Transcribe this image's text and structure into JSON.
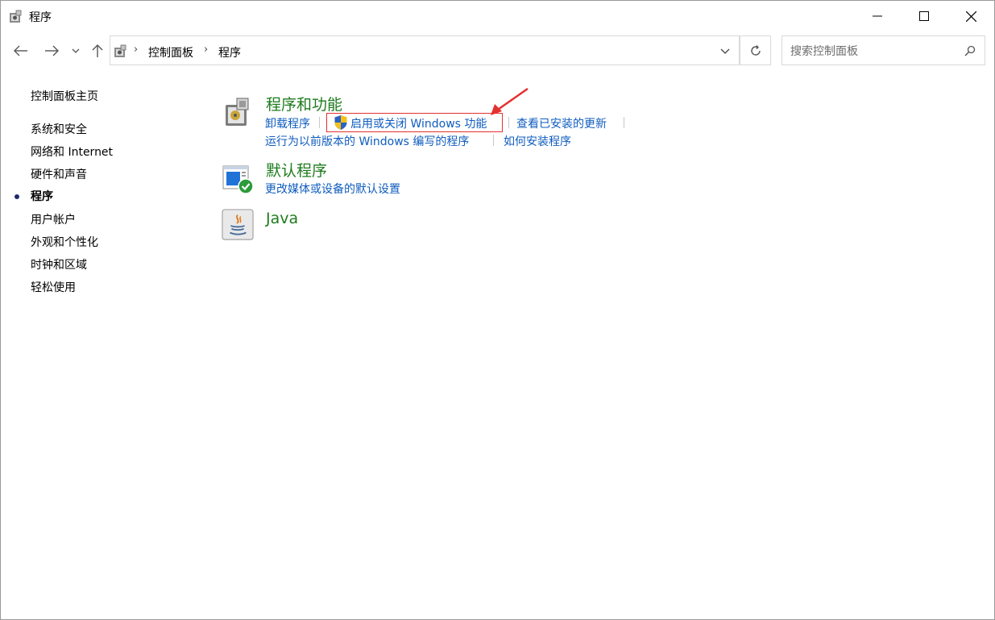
{
  "window": {
    "title": "程序",
    "icon": "programs-icon"
  },
  "nav": {
    "back_icon": "back-arrow-icon",
    "forward_icon": "forward-arrow-icon",
    "recent_icon": "chevron-down-icon",
    "up_icon": "up-arrow-icon"
  },
  "address": {
    "breadcrumbs": [
      "控制面板",
      "程序"
    ],
    "refresh_icon": "refresh-icon"
  },
  "search": {
    "placeholder": "搜索控制面板",
    "value": ""
  },
  "sidebar": {
    "home": "控制面板主页",
    "items": [
      {
        "label": "系统和安全",
        "active": false
      },
      {
        "label": "网络和 Internet",
        "active": false
      },
      {
        "label": "硬件和声音",
        "active": false
      },
      {
        "label": "程序",
        "active": true
      },
      {
        "label": "用户帐户",
        "active": false
      },
      {
        "label": "外观和个性化",
        "active": false
      },
      {
        "label": "时钟和区域",
        "active": false
      },
      {
        "label": "轻松使用",
        "active": false
      }
    ]
  },
  "categories": [
    {
      "title": "程序和功能",
      "icon": "programs-features-icon",
      "links": [
        "卸载程序",
        "启用或关闭 Windows 功能",
        "查看已安装的更新",
        "运行为以前版本的 Windows 编写的程序",
        "如何安装程序"
      ]
    },
    {
      "title": "默认程序",
      "icon": "default-programs-icon",
      "links": [
        "更改媒体或设备的默认设置"
      ]
    },
    {
      "title": "Java",
      "icon": "java-icon",
      "links": []
    }
  ],
  "annotation": {
    "highlight_color": "#e53030"
  },
  "colors": {
    "category_title": "#1e7b1e",
    "link": "#0f5cbf",
    "active_bullet": "#1e2a6e"
  }
}
